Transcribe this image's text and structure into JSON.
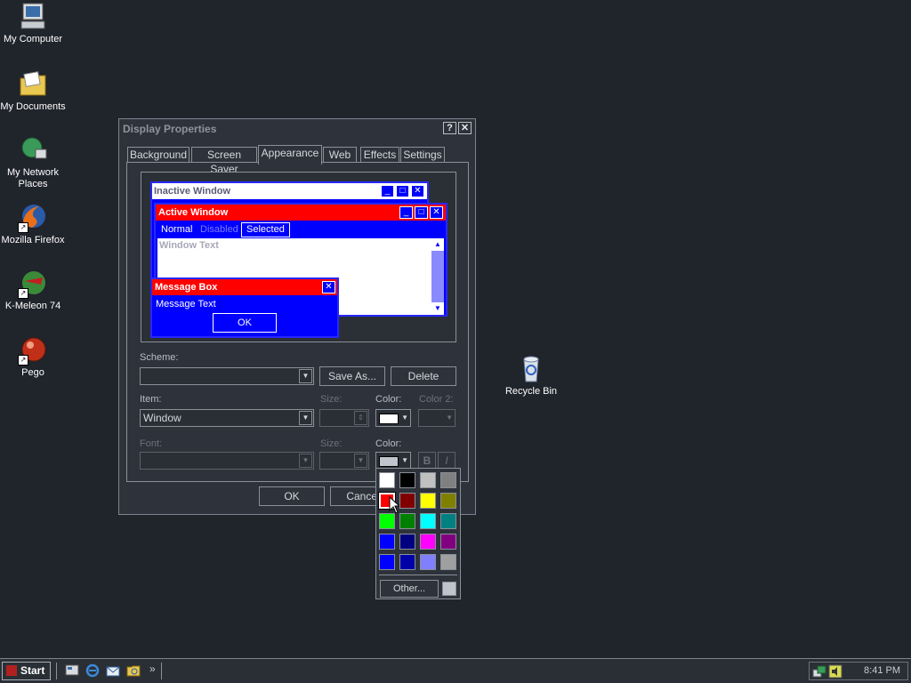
{
  "desktop": {
    "icons": [
      {
        "name": "my-computer",
        "label": "My Computer"
      },
      {
        "name": "my-documents",
        "label": "My Documents"
      },
      {
        "name": "my-network-places",
        "label": "My Network Places"
      },
      {
        "name": "mozilla-firefox",
        "label": "Mozilla Firefox"
      },
      {
        "name": "k-meleon",
        "label": "K-Meleon 74"
      },
      {
        "name": "pego",
        "label": "Pego"
      },
      {
        "name": "recycle-bin",
        "label": "Recycle Bin"
      }
    ]
  },
  "dialog": {
    "title": "Display Properties",
    "help_glyph": "?",
    "close_glyph": "✕",
    "tabs": [
      "Background",
      "Screen Saver",
      "Appearance",
      "Web",
      "Effects",
      "Settings"
    ],
    "active_tab": "Appearance"
  },
  "preview": {
    "inactive_title": "Inactive Window",
    "active_title": "Active Window",
    "menu_normal": "Normal",
    "menu_disabled": "Disabled",
    "menu_selected": "Selected",
    "window_text": "Window Text",
    "message_box_title": "Message Box",
    "message_text": "Message Text",
    "ok_label": "OK"
  },
  "form": {
    "scheme_label": "Scheme:",
    "scheme_value": "",
    "save_as_label": "Save As...",
    "delete_label": "Delete",
    "item_label": "Item:",
    "item_value": "Window",
    "size_label": "Size:",
    "color_label": "Color:",
    "color2_label": "Color 2:",
    "font_label": "Font:",
    "font_size_label": "Size:",
    "font_color_label": "Color:",
    "bold_label": "B",
    "italic_label": "I",
    "item_color": "#ffffff",
    "font_color": "#c0c4cc"
  },
  "footer": {
    "ok_label": "OK",
    "cancel_label": "Cancel"
  },
  "color_popup": {
    "colors": [
      "#ffffff",
      "#000000",
      "#c0c0c0",
      "#808080",
      "#ff0000",
      "#800000",
      "#ffff00",
      "#808000",
      "#00ff00",
      "#008000",
      "#00ffff",
      "#008080",
      "#0000ff",
      "#000080",
      "#ff00ff",
      "#800080",
      "#0000ff",
      "#0000a8",
      "#8080ff",
      "#a0a0a0"
    ],
    "selected_index": 4,
    "other_label": "Other...",
    "other_swatch": "#c0c4cc"
  },
  "taskbar": {
    "start_label": "Start",
    "quicklaunch_more": "»",
    "clock": "8:41 PM"
  }
}
